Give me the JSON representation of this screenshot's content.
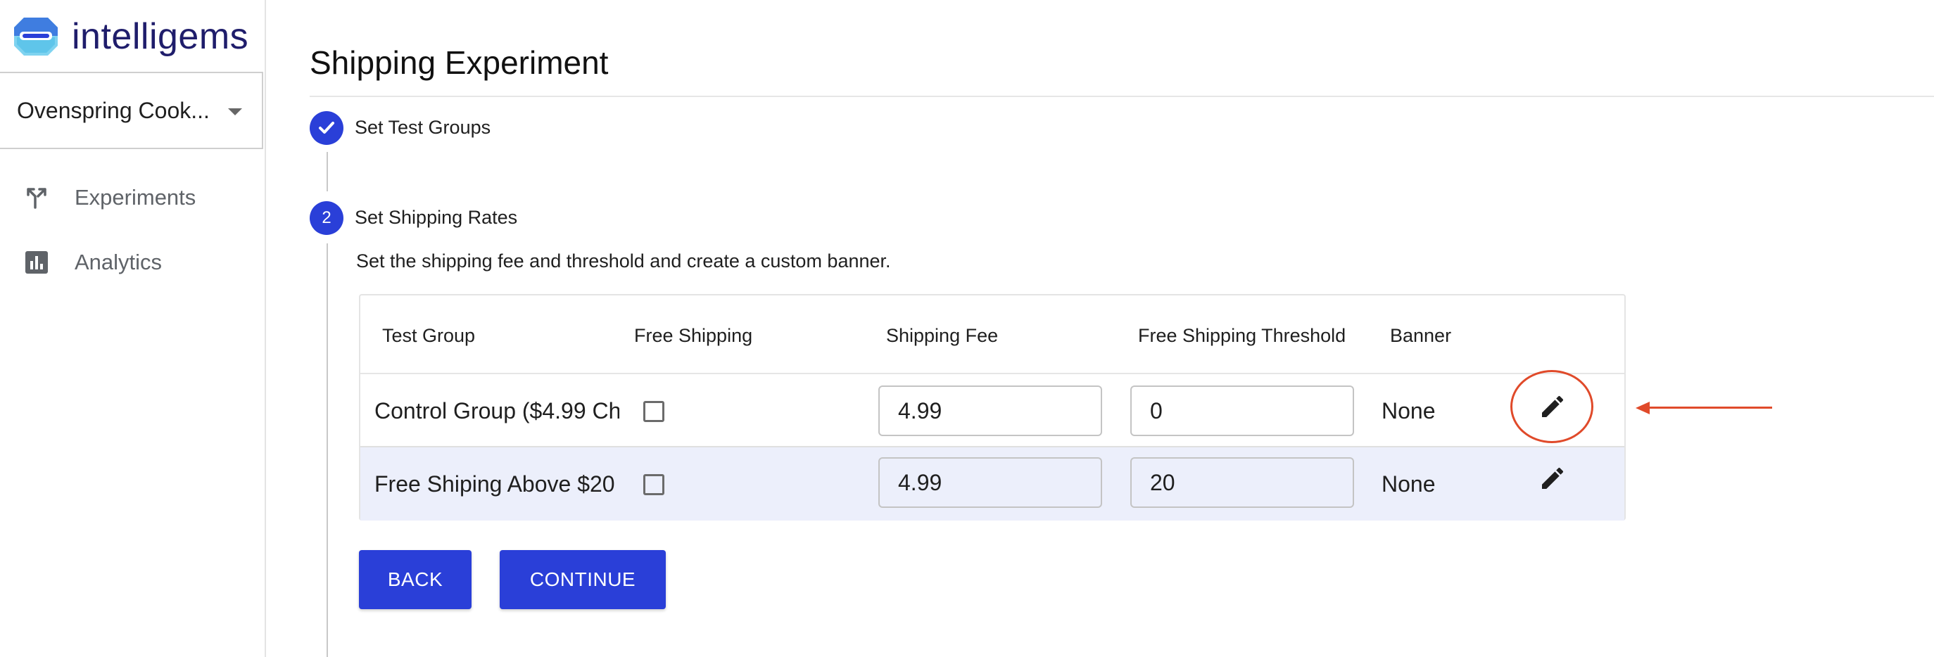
{
  "brand": {
    "name": "intelligems"
  },
  "store_selector": {
    "value": "Ovenspring Cook..."
  },
  "sidebar": {
    "items": [
      {
        "label": "Experiments",
        "icon": "experiments-icon"
      },
      {
        "label": "Analytics",
        "icon": "analytics-icon"
      }
    ]
  },
  "page": {
    "title": "Shipping Experiment"
  },
  "steps": [
    {
      "number": "",
      "label": "Set Test Groups",
      "status": "completed"
    },
    {
      "number": "2",
      "label": "Set Shipping Rates",
      "status": "active",
      "description": "Set the shipping fee and threshold and create a custom banner."
    }
  ],
  "table": {
    "headers": [
      "Test Group",
      "Free Shipping",
      "Shipping Fee",
      "Free Shipping Threshold",
      "Banner"
    ],
    "rows": [
      {
        "test_group": "Control Group ($4.99 Ch",
        "free_shipping": false,
        "shipping_fee": "4.99",
        "threshold": "0",
        "banner": "None"
      },
      {
        "test_group": "Free Shiping Above $20",
        "free_shipping": false,
        "shipping_fee": "4.99",
        "threshold": "20",
        "banner": "None"
      }
    ]
  },
  "buttons": {
    "back": "BACK",
    "continue": "CONTINUE"
  },
  "colors": {
    "primary": "#2a3fd8",
    "annotation": "#e04a2a",
    "row_highlight": "#eceffb",
    "brand_text": "#1f1d6b"
  }
}
